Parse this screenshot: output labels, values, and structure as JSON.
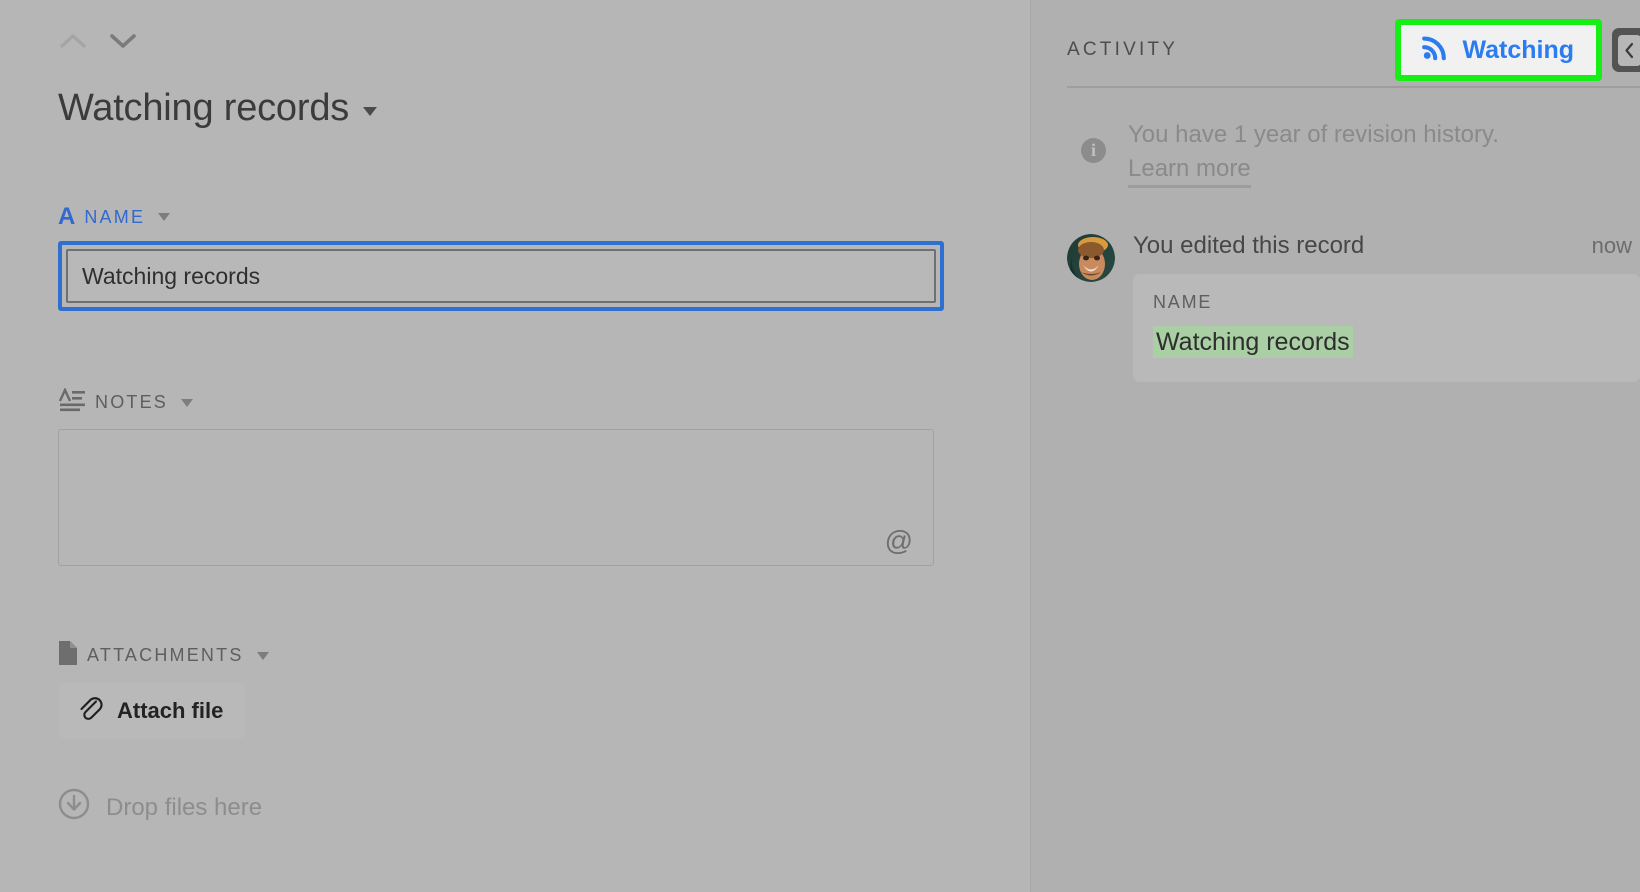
{
  "left_panel": {
    "nav": {
      "prev_record_icon": "chevron-up-icon",
      "next_record_icon": "chevron-down-icon"
    },
    "record_title": "Watching records",
    "fields": [
      {
        "label": "NAME",
        "icon": "single-line-text-icon",
        "icon_glyph": "A",
        "value": "Watching records"
      },
      {
        "label": "NOTES",
        "icon": "long-text-icon",
        "value": "",
        "mention_icon": "at-mention-icon"
      },
      {
        "label": "ATTACHMENTS",
        "icon": "attachment-file-icon"
      }
    ],
    "attach_button": {
      "label": "Attach file",
      "icon": "paperclip-icon"
    },
    "drop_zone": {
      "label": "Drop files here",
      "icon": "download-arrow-icon"
    }
  },
  "right_panel": {
    "header": {
      "title": "ACTIVITY",
      "watching_button": {
        "label": "Watching",
        "icon": "rss-broadcast-icon",
        "text_color": "#2b7cf0",
        "highlight_color": "#16ef16"
      },
      "collapse_button": {
        "icon": "chevron-left-icon"
      }
    },
    "revision_notice": {
      "icon": "info-icon",
      "icon_glyph": "i",
      "text": "You have 1 year of revision history. ",
      "link_label": "Learn more"
    },
    "activity_entries": [
      {
        "avatar": "user-avatar-photo",
        "action_text": "You edited this record",
        "timestamp": "now",
        "diff": {
          "field_label": "NAME",
          "new_value": "Watching records",
          "highlight_color": "#aacfa5"
        }
      }
    ]
  }
}
